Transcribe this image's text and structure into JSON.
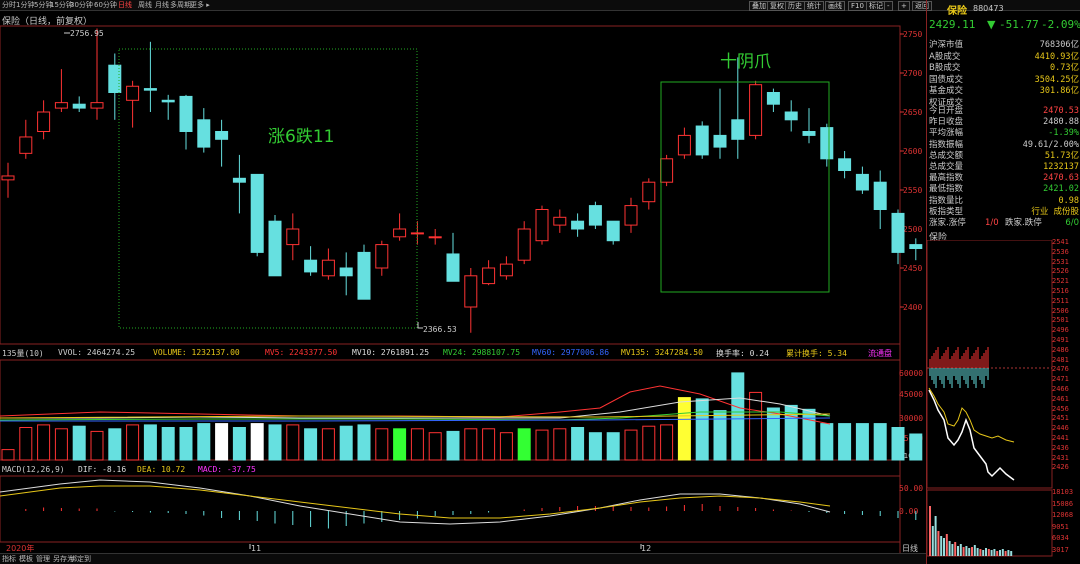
{
  "toolbar": {
    "tabs": [
      "分时",
      "1分钟",
      "5分钟",
      "15分钟",
      "30分钟",
      "60分钟",
      "日线",
      "周线",
      "月线",
      "多周期",
      "更多"
    ],
    "active": "日线",
    "right_buttons": [
      "叠加",
      "复权",
      "历史",
      "统计",
      "画线",
      "F10",
      "标记",
      "-",
      "+",
      "返回"
    ]
  },
  "chart": {
    "title": "保险（日线，前复权）",
    "high_label": "2756.95",
    "low_label": "2366.53",
    "annotation1": "涨6跌11",
    "annotation2": "十阴爪",
    "y_ticks": [
      "2750",
      "2700",
      "2650",
      "2600",
      "2550",
      "2500",
      "2450",
      "2400"
    ],
    "x_labels": [
      "2020年",
      "11",
      "12"
    ],
    "period_label": "日线"
  },
  "volume": {
    "title": "135量(10)",
    "vvol": "VVOL: 2464274.25",
    "volume": "VOLUME: 1232137.00",
    "mv5": "MV5: 2243377.50",
    "mv10": "MV10: 2761891.25",
    "mv24": "MV24: 2988107.75",
    "mv60": "MV60: 2977006.86",
    "mv135": "MV135: 3247284.50",
    "turnover": "换手率: 0.24",
    "cum_turnover": "累计换手: 5.34",
    "float": "流通盘",
    "ticks": [
      "60000",
      "45000",
      "30000",
      "15000"
    ],
    "unit": "X100"
  },
  "macd": {
    "title": "MACD(12,26,9)",
    "dif": "DIF: -8.16",
    "dea": "DEA: 10.72",
    "macd": "MACD: -37.75",
    "ticks": [
      "50.00",
      "0.00"
    ]
  },
  "sidebar": {
    "name": "保险",
    "code": "880473",
    "price": "2429.11",
    "change": "-51.77",
    "pct": "-2.09%",
    "rows": [
      {
        "k": "沪深市值",
        "v": "768306亿",
        "c": "#cccccc"
      },
      {
        "k": "A股成交",
        "v": "4410.93亿",
        "c": "#e6c619"
      },
      {
        "k": "B股成交",
        "v": "0.73亿",
        "c": "#e6c619"
      },
      {
        "k": "国债成交",
        "v": "3504.25亿",
        "c": "#e6c619"
      },
      {
        "k": "基金成交",
        "v": "301.86亿",
        "c": "#e6c619"
      },
      {
        "k": "权证成交",
        "v": "",
        "c": "#e6c619"
      },
      {
        "k": "今日开盘",
        "v": "2470.53",
        "c": "#ff4444"
      },
      {
        "k": "昨日收盘",
        "v": "2480.88",
        "c": "#cccccc"
      },
      {
        "k": "平均涨幅",
        "v": "-1.39%",
        "c": "#33cc33"
      },
      {
        "k": "指数振幅",
        "v": "49.61/2.00%",
        "c": "#cccccc"
      },
      {
        "k": "总成交额",
        "v": "51.73亿",
        "c": "#e6c619"
      },
      {
        "k": "总成交量",
        "v": "1232137",
        "c": "#e6c619"
      },
      {
        "k": "最高指数",
        "v": "2470.63",
        "c": "#ff4444"
      },
      {
        "k": "最低指数",
        "v": "2421.02",
        "c": "#33cc33"
      },
      {
        "k": "指数量比",
        "v": "0.98",
        "c": "#e6c619"
      },
      {
        "k": "板指类型",
        "v": "行业 成份股",
        "c": "#e6c619"
      }
    ],
    "updown": "涨家.涨停",
    "updown_v": "1/0",
    "downlbl": "跌家.跌停",
    "downv": "6/0",
    "mini_title": "保险",
    "mini_ticks": [
      "2541",
      "2536",
      "2531",
      "2526",
      "2521",
      "2516",
      "2511",
      "2506",
      "2501",
      "2496",
      "2491",
      "2486",
      "2481",
      "2476",
      "2471",
      "2466",
      "2461",
      "2456",
      "2451",
      "2446",
      "2441",
      "2436",
      "2431",
      "2426"
    ],
    "mini_vol_ticks": [
      "18103",
      "15086",
      "12068",
      "9051",
      "6034",
      "3017"
    ]
  },
  "bottom": {
    "tabs": [
      "指标",
      "模板",
      "管理",
      "另存为",
      "绑定到"
    ]
  },
  "colors": {
    "up": "#ff3333",
    "down": "#66e0e0",
    "ma": "#e6c619"
  }
}
